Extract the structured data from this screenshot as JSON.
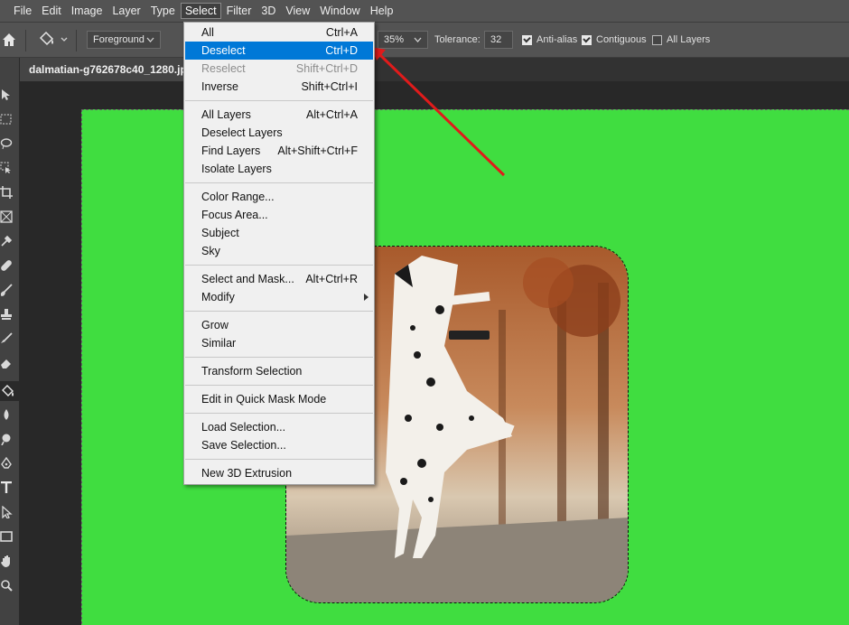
{
  "menubar": {
    "items": [
      "File",
      "Edit",
      "Image",
      "Layer",
      "Type",
      "Select",
      "Filter",
      "3D",
      "View",
      "Window",
      "Help"
    ],
    "active": "Select"
  },
  "options": {
    "foreground": "Foreground",
    "opacity": "35%",
    "tolerance_label": "Tolerance:",
    "tolerance_value": "32",
    "anti_alias": "Anti-alias",
    "contiguous": "Contiguous",
    "all_layers": "All Layers"
  },
  "document": {
    "tab_title": "dalmatian-g762678c40_1280.jp"
  },
  "select_menu": {
    "groups": [
      [
        {
          "label": "All",
          "shortcut": "Ctrl+A"
        },
        {
          "label": "Deselect",
          "shortcut": "Ctrl+D"
        },
        {
          "label": "Reselect",
          "shortcut": "Shift+Ctrl+D"
        },
        {
          "label": "Inverse",
          "shortcut": "Shift+Ctrl+I"
        }
      ],
      [
        {
          "label": "All Layers",
          "shortcut": "Alt+Ctrl+A"
        },
        {
          "label": "Deselect Layers",
          "shortcut": ""
        },
        {
          "label": "Find Layers",
          "shortcut": "Alt+Shift+Ctrl+F"
        },
        {
          "label": "Isolate Layers",
          "shortcut": ""
        }
      ],
      [
        {
          "label": "Color Range...",
          "shortcut": ""
        },
        {
          "label": "Focus Area...",
          "shortcut": ""
        },
        {
          "label": "Subject",
          "shortcut": ""
        },
        {
          "label": "Sky",
          "shortcut": ""
        }
      ],
      [
        {
          "label": "Select and Mask...",
          "shortcut": "Alt+Ctrl+R"
        },
        {
          "label": "Modify",
          "shortcut": ""
        }
      ],
      [
        {
          "label": "Grow",
          "shortcut": ""
        },
        {
          "label": "Similar",
          "shortcut": ""
        }
      ],
      [
        {
          "label": "Transform Selection",
          "shortcut": ""
        }
      ],
      [
        {
          "label": "Edit in Quick Mask Mode",
          "shortcut": ""
        }
      ],
      [
        {
          "label": "Load Selection...",
          "shortcut": ""
        },
        {
          "label": "Save Selection...",
          "shortcut": ""
        }
      ],
      [
        {
          "label": "New 3D Extrusion",
          "shortcut": ""
        }
      ]
    ]
  },
  "colors": {
    "canvas_green": "#40dd40",
    "highlight": "#0078d7",
    "annotation_arrow": "#e01b1b"
  }
}
